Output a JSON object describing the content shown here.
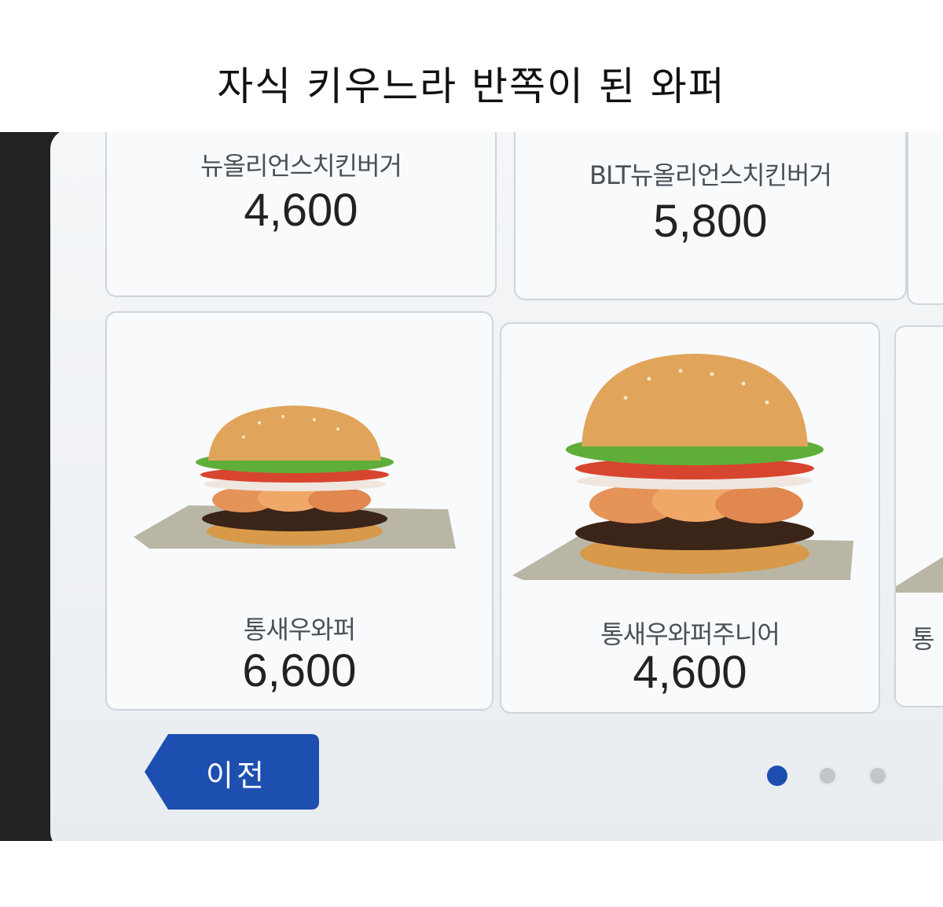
{
  "caption": "자식 키우느라 반쪽이 된 와퍼",
  "menu": {
    "items": [
      {
        "name": "뉴올리언스치킨버거",
        "price": "4,600"
      },
      {
        "name": "BLT뉴올리언스치킨버거",
        "price": "5,800"
      },
      {
        "name": "통새우와퍼",
        "price": "6,600"
      },
      {
        "name": "통새우와퍼주니어",
        "price": "4,600"
      },
      {
        "name": "통"
      }
    ]
  },
  "nav": {
    "prev_label": "이전",
    "current_page": 1,
    "total_pages": 3
  },
  "colors": {
    "accent": "#1d4fb0",
    "dot_active": "#1d4fb0",
    "dot_inactive": "#c2c6cb"
  }
}
